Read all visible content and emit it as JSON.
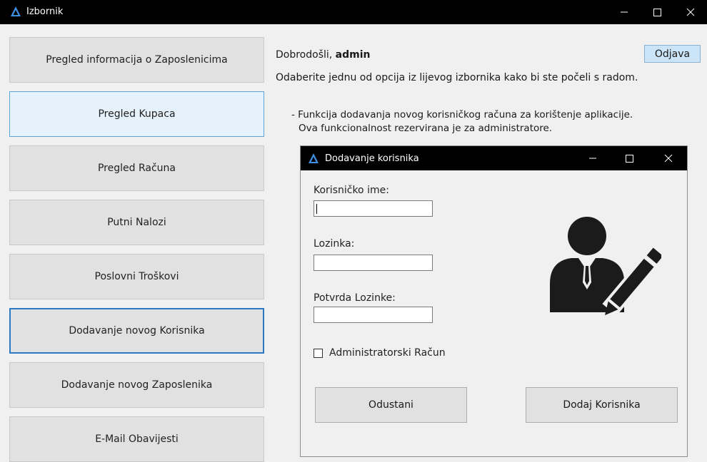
{
  "window": {
    "title": "Izbornik"
  },
  "menu": {
    "items": [
      {
        "label": "Pregled informacija o Zaposlenicima"
      },
      {
        "label": "Pregled Kupaca"
      },
      {
        "label": "Pregled Računa"
      },
      {
        "label": "Putni Nalozi"
      },
      {
        "label": "Poslovni Troškovi"
      },
      {
        "label": "Dodavanje novog Korisnika"
      },
      {
        "label": "Dodavanje novog Zaposlenika"
      },
      {
        "label": "E-Mail Obavijesti"
      }
    ]
  },
  "header": {
    "greeting": "Dobrodošli, ",
    "username": "admin",
    "logout_label": "Odjava",
    "instruction": "Odaberite jednu od opcija iz lijevog izbornika kako bi ste počeli s radom.",
    "description_line1": "- Funkcija dodavanja novog korisničkog računa za korištenje aplikacije.",
    "description_line2": "Ova funkcionalnost rezervirana je za administratore."
  },
  "dialog": {
    "title": "Dodavanje korisnika",
    "username_label": "Korisničko ime:",
    "username_value": "",
    "password_label": "Lozinka:",
    "password_value": "",
    "confirm_label": "Potvrda Lozinke:",
    "confirm_value": "",
    "admin_checkbox_label": "Administratorski Račun",
    "admin_checked": false,
    "cancel_label": "Odustani",
    "submit_label": "Dodaj Korisnika"
  },
  "colors": {
    "accent": "#2a7ac4",
    "hover": "#e5f1fb",
    "logo": "#3d8fe0"
  },
  "icons": [
    "app-logo-icon",
    "minimize-icon",
    "maximize-icon",
    "close-icon",
    "user-edit-icon",
    "checkbox-icon"
  ]
}
